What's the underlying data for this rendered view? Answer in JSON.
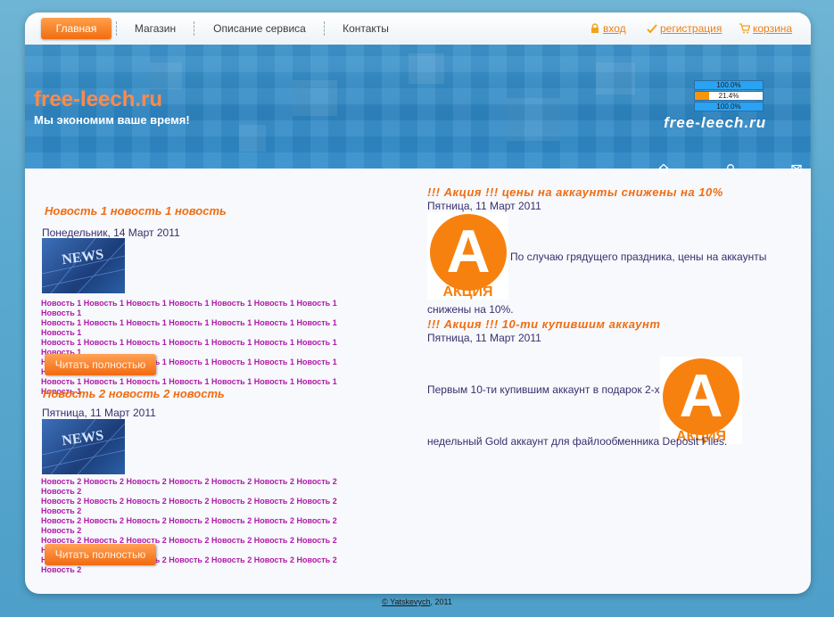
{
  "nav": {
    "items": [
      "Главная",
      "Магазин",
      "Описание сервиса",
      "Контакты"
    ],
    "login": "вход",
    "register": "регистрация",
    "cart": "корзина"
  },
  "banner": {
    "site_name": "free-leech.ru",
    "slogan": "Мы экономим ваше время!",
    "progress": [
      {
        "label": "100.0%",
        "value": 100.0,
        "color": "#29a3f2"
      },
      {
        "label": "21.4%",
        "value": 21.4,
        "color": "#f7960e"
      },
      {
        "label": "100.0%",
        "value": 100.0,
        "color": "#29a3f2"
      }
    ],
    "logo_text": "free-leech.ru",
    "icons": [
      "home-icon",
      "search-icon",
      "mail-icon"
    ]
  },
  "news": [
    {
      "title": "Новость 1 новость 1 новость",
      "date": "Понедельник, 14 Март 2011",
      "image_label": "NEWS",
      "lines": [
        "Новость 1 Новость 1 Новость 1 Новость 1 Новость 1 Новость 1 Новость 1 Новость 1",
        "Новость 1 Новость 1 Новость 1 Новость 1 Новость 1 Новость 1 Новость 1 Новость 1",
        "Новость 1 Новость 1 Новость 1 Новость 1 Новость 1 Новость 1 Новость 1 Новость 1",
        "Новость 1 Новость 1 Новость 1 Новость 1 Новость 1 Новость 1 Новость 1 Новость 1",
        "Новость 1 Новость 1 Новость 1 Новость 1 Новость 1 Новость 1 Новость 1 Новость 1"
      ],
      "read_more": "Читать полностью"
    },
    {
      "title": "Новость 2 новость 2 новость",
      "date": "Пятница, 11 Март 2011",
      "image_label": "NEWS",
      "lines": [
        "Новость 2 Новость 2 Новость 2 Новость 2 Новость 2 Новость 2 Новость 2 Новость 2",
        "Новость 2 Новость 2 Новость 2 Новость 2 Новость 2 Новость 2 Новость 2 Новость 2",
        "Новость 2 Новость 2 Новость 2 Новость 2 Новость 2 Новость 2 Новость 2 Новость 2",
        "Новость 2 Новость 2 Новость 2 Новость 2 Новость 2 Новость 2 Новость 2 Новость 2",
        "Новость 2 Новость 2 Новость 2 Новость 2 Новость 2 Новость 2 Новость 2 Новость 2"
      ],
      "read_more": "Читать полностью"
    }
  ],
  "promos": [
    {
      "title": "!!! Акция !!! цены на аккаунты снижены на 10%",
      "date": "Пятница, 11 Март 2011",
      "text_line1": "По случаю грядущего праздника, цены на аккаунты",
      "text_line2": "снижены на 10%.",
      "badge_letter": "A",
      "badge_label": "АКЦИЯ"
    },
    {
      "title": "!!! Акция !!! 10-ти купившим аккаунт",
      "date": "Пятница, 11 Март 2011",
      "text_line1": "Первым 10-ти купившим аккаунт в подарок 2-х",
      "text_line2": "недельный Gold аккаунт для файлообменника Deposit Files.",
      "badge_letter": "A",
      "badge_label": "АКЦИЯ"
    }
  ],
  "footer": {
    "author": "© Yatskevych",
    "year": ", 2011"
  },
  "colors": {
    "accent": "#f06d12",
    "banner_blue": "#2d86c3",
    "news_text": "#b01aa8"
  }
}
